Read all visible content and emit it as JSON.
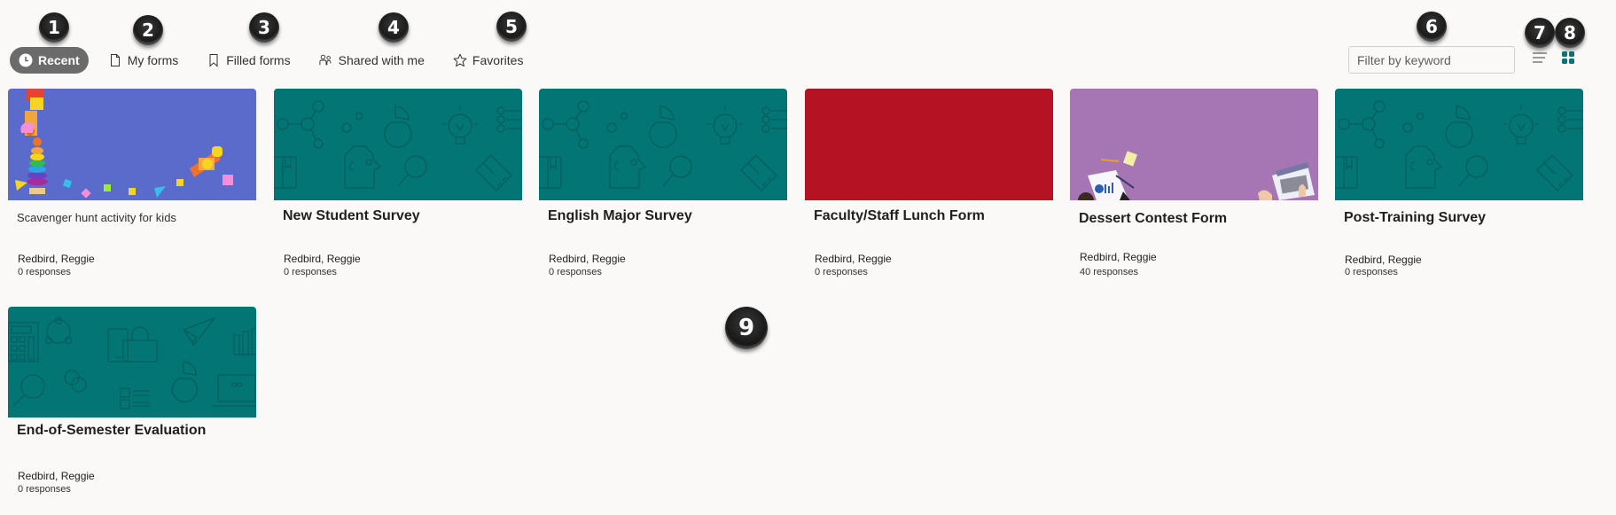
{
  "nav": {
    "tabs": [
      {
        "label": "Recent",
        "icon": "clock-icon",
        "active": true
      },
      {
        "label": "My forms",
        "icon": "document-icon",
        "active": false
      },
      {
        "label": "Filled forms",
        "icon": "bookmark-icon",
        "active": false
      },
      {
        "label": "Shared with me",
        "icon": "people-icon",
        "active": false
      },
      {
        "label": "Favorites",
        "icon": "star-icon",
        "active": false
      }
    ]
  },
  "filter": {
    "placeholder": "Filter by keyword",
    "value": ""
  },
  "view_toggle": {
    "list_icon": "list-view-icon",
    "grid_icon": "grid-view-icon",
    "active": "grid",
    "accent": "#037575"
  },
  "forms": [
    {
      "title": "Scavenger hunt activity for kids",
      "author": "Redbird, Reggie",
      "responses": "0 responses",
      "theme": "toys-photo",
      "color": "#5a6bcb"
    },
    {
      "title": "New Student Survey",
      "author": "Redbird, Reggie",
      "responses": "0 responses",
      "theme": "teal-icons",
      "color": "#037575"
    },
    {
      "title": "English Major Survey",
      "author": "Redbird, Reggie",
      "responses": "0 responses",
      "theme": "teal-icons",
      "color": "#037575"
    },
    {
      "title": "Faculty/Staff Lunch Form",
      "author": "Redbird, Reggie",
      "responses": "0 responses",
      "theme": "solid-red",
      "color": "#b51223"
    },
    {
      "title": "Dessert Contest Form",
      "author": "Redbird, Reggie",
      "responses": "40 responses",
      "theme": "purple-desk",
      "color": "#a676b4"
    },
    {
      "title": "Post-Training Survey",
      "author": "Redbird, Reggie",
      "responses": "0 responses",
      "theme": "teal-icons",
      "color": "#037575"
    },
    {
      "title": "End-of-Semester Evaluation",
      "author": "Redbird, Reggie",
      "responses": "0 responses",
      "theme": "teal-icons-2",
      "color": "#037575"
    }
  ],
  "annotations": [
    "1",
    "2",
    "3",
    "4",
    "5",
    "6",
    "7",
    "8",
    "9"
  ]
}
